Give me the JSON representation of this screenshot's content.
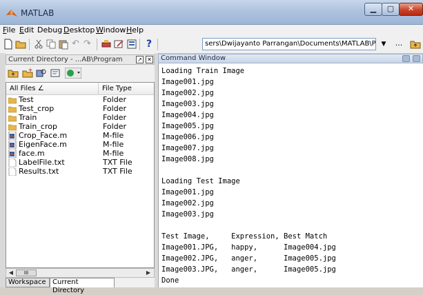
{
  "window": {
    "title": "MATLAB"
  },
  "menu": [
    {
      "label": "File",
      "accel": "F",
      "rest": "ile"
    },
    {
      "label": "Edit",
      "accel": "E",
      "rest": "dit"
    },
    {
      "label": "Debug",
      "accel": "",
      "rest": "Debug"
    },
    {
      "label": "Desktop",
      "accel": "D",
      "rest": "esktop"
    },
    {
      "label": "Window",
      "accel": "W",
      "rest": "indow"
    },
    {
      "label": "Help",
      "accel": "H",
      "rest": "elp"
    }
  ],
  "toolbar": {
    "current_path": "sers\\Dwijayanto Parrangan\\Documents\\MATLAB\\Program",
    "dropdown_glyph": "▼",
    "browse_label": "..."
  },
  "current_directory": {
    "title": "Current Directory - ...AB\\Program",
    "columns": {
      "name": "All Files  ∠",
      "type": "File Type"
    },
    "files": [
      {
        "name": "Test",
        "type": "Folder",
        "icon": "folder-icon"
      },
      {
        "name": "Test_crop",
        "type": "Folder",
        "icon": "folder-icon"
      },
      {
        "name": "Train",
        "type": "Folder",
        "icon": "folder-icon"
      },
      {
        "name": "Train_crop",
        "type": "Folder",
        "icon": "folder-icon"
      },
      {
        "name": "Crop_Face.m",
        "type": "M-file",
        "icon": "m-file-icon"
      },
      {
        "name": "EigenFace.m",
        "type": "M-file",
        "icon": "m-file-icon"
      },
      {
        "name": "face.m",
        "type": "M-file",
        "icon": "m-file-icon"
      },
      {
        "name": "LabelFile.txt",
        "type": "TXT File",
        "icon": "text-file-icon"
      },
      {
        "name": "Results.txt",
        "type": "TXT File",
        "icon": "text-file-icon"
      }
    ],
    "scroll_thumb": "III",
    "tabs": [
      "Workspace",
      "Current Directory"
    ]
  },
  "command_window": {
    "title": "Command Window",
    "lines": [
      "Loading Train Image",
      "Image001.jpg",
      "Image002.jpg",
      "Image003.jpg",
      "Image004.jpg",
      "Image005.jpg",
      "Image006.jpg",
      "Image007.jpg",
      "Image008.jpg",
      "",
      "Loading Test Image",
      "Image001.jpg",
      "Image002.jpg",
      "Image003.jpg",
      "",
      "Test Image,     Expression, Best Match",
      "Image001.JPG,   happy,      Image004.jpg",
      "Image002.JPG,   anger,      Image005.jpg",
      "Image003.JPG,   anger,      Image005.jpg",
      "Done"
    ]
  },
  "colors": {
    "folder": "#e8b64a",
    "mfile": "#2a5ca8",
    "accent": "#c7442b"
  }
}
